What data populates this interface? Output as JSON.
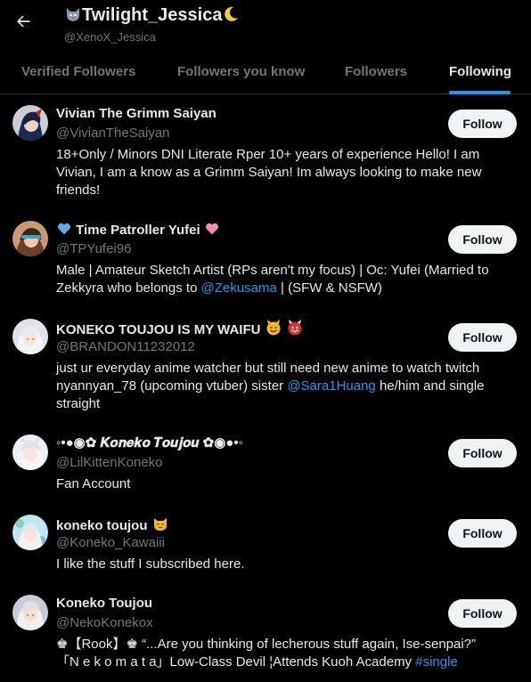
{
  "header": {
    "title": "Twilight_Jessica",
    "handle": "@XenoX_Jessica"
  },
  "tabs": [
    {
      "label": "Verified Followers"
    },
    {
      "label": "Followers you know"
    },
    {
      "label": "Followers"
    },
    {
      "label": "Following",
      "active": true
    }
  ],
  "users": [
    {
      "name": "Vivian The Grimm Saiyan",
      "handle": "@VivianTheSaiyan",
      "bio": "18+Only / Minors DNI Literate Rper 10+ years of experience Hello! I am Vivian, I am a know as a Grimm Saiyan! Im always looking to make new friends!",
      "follow_label": "Follow"
    },
    {
      "name": "Time Patroller Yufei",
      "handle": "@TPYufei96",
      "bio_before": "Male | Amateur Sketch Artist (RPs aren't my focus) | Oc: Yufei (Married to Zekkyra who belongs to ",
      "bio_link": "@Zekusama",
      "bio_after": " | (SFW & NSFW)",
      "follow_label": "Follow"
    },
    {
      "name": "KONEKO TOUJOU IS MY WAIFU",
      "handle": "@BRANDON11232012",
      "bio_before": "just ur everyday anime watcher but still need new anime to watch twitch nyannyan_78 (upcoming vtuber) sister ",
      "bio_link": "@Sara1Huang",
      "bio_after": " he/him and single straight",
      "follow_label": "Follow"
    },
    {
      "name": "◦•●◉✿ 𝑲𝒐𝒏𝒆𝒌𝒐 𝑻𝒐𝒖𝒋𝒐𝒖 ✿◉●•◦",
      "handle": "@LilKittenKoneko",
      "bio": "Fan Account",
      "follow_label": "Follow"
    },
    {
      "name": "koneko toujou",
      "handle": "@Koneko_Kawaiii",
      "bio": "I like the stuff I subscribed here.",
      "follow_label": "Follow"
    },
    {
      "name": "Koneko Toujou",
      "handle": "@NekoKonekox",
      "bio_line1": "♚【Rook】♚ “...Are you thinking of lecherous stuff again, Ise-senpai?”",
      "bio_line2_before": "「N e k o m a t a」Low-Class Devil ¦Attends Kuoh Academy ",
      "bio_link": "#single",
      "follow_label": "Follow"
    }
  ],
  "colors": {
    "background": "#000000",
    "accent": "#1d9bf0",
    "text_primary": "#e7e9ea",
    "text_secondary": "#71767b",
    "button_bg": "#eff3f4"
  }
}
